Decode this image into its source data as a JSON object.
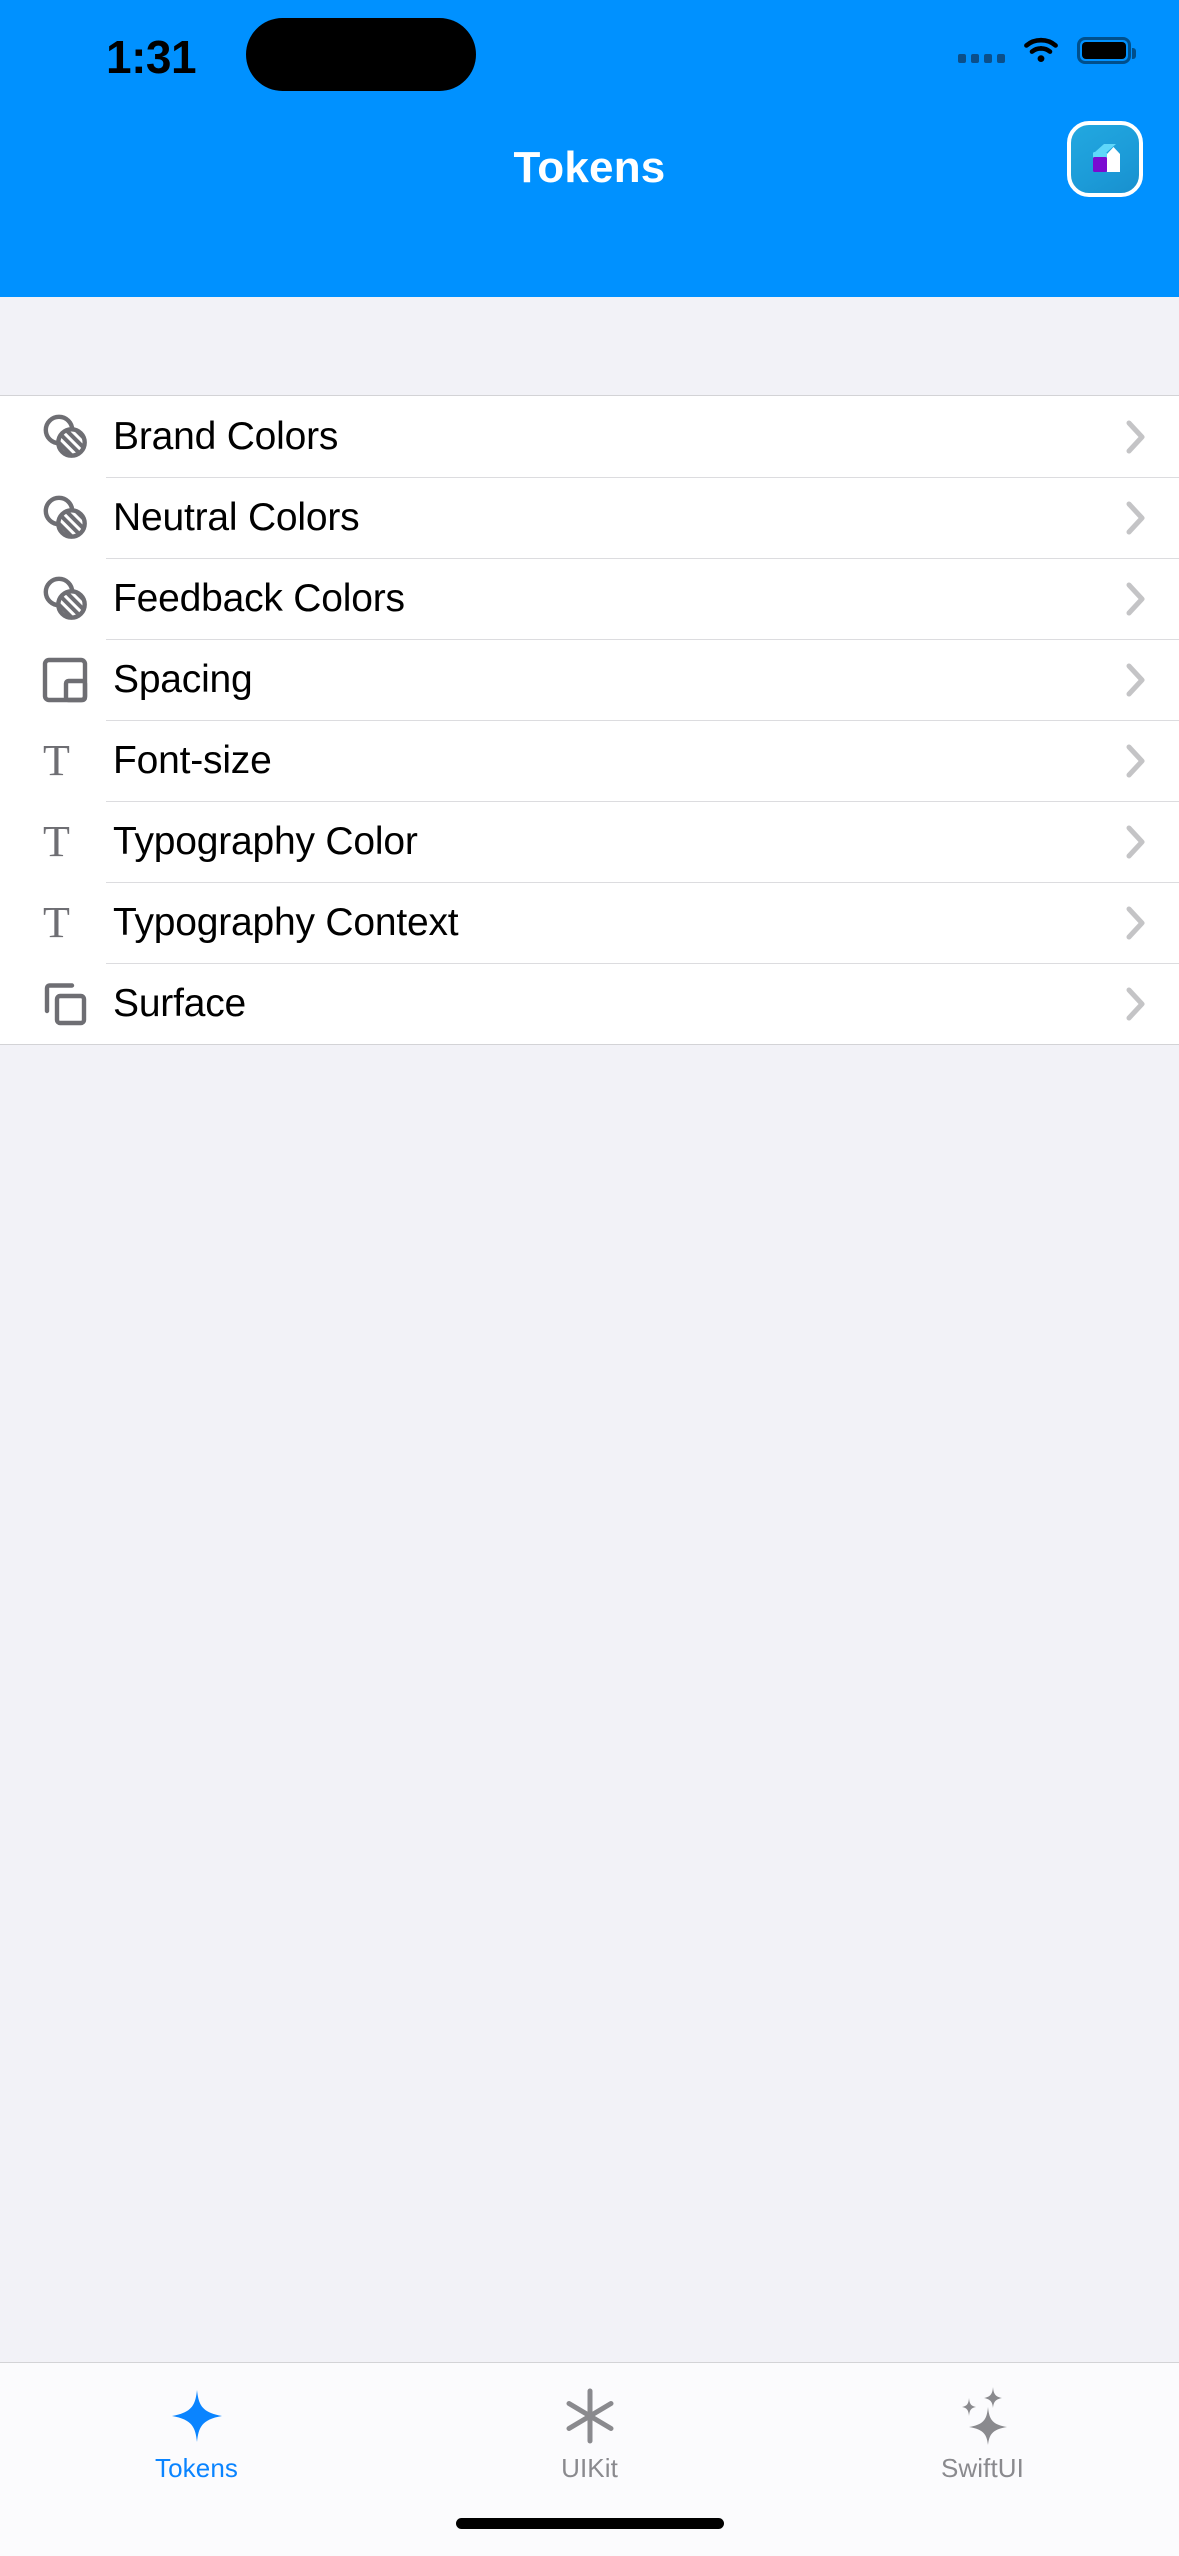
{
  "status_bar": {
    "time": "1:31",
    "cellular_icon": "cellular-bars-icon",
    "wifi_icon": "wifi-icon",
    "battery_icon": "battery-full-icon"
  },
  "nav": {
    "title": "Tokens",
    "right_button_icon": "app-logo-icon",
    "background_color": "#0091FF",
    "title_color": "#FFFFFF"
  },
  "list": {
    "rows": [
      {
        "label": "Brand Colors",
        "icon": "overlapping-circles-icon",
        "accessory": "chevron-right-icon"
      },
      {
        "label": "Neutral Colors",
        "icon": "overlapping-circles-icon",
        "accessory": "chevron-right-icon"
      },
      {
        "label": "Feedback Colors",
        "icon": "overlapping-circles-icon",
        "accessory": "chevron-right-icon"
      },
      {
        "label": "Spacing",
        "icon": "square-inset-icon",
        "accessory": "chevron-right-icon"
      },
      {
        "label": "Font-size",
        "icon": "textformat-t-icon",
        "accessory": "chevron-right-icon"
      },
      {
        "label": "Typography Color",
        "icon": "textformat-t-icon",
        "accessory": "chevron-right-icon"
      },
      {
        "label": "Typography Context",
        "icon": "textformat-t-icon",
        "accessory": "chevron-right-icon"
      },
      {
        "label": "Surface",
        "icon": "square-on-square-icon",
        "accessory": "chevron-right-icon"
      }
    ],
    "row_text_color": "#000000",
    "icon_color": "#6E6E73",
    "chevron_color": "#C4C4C6",
    "background_color": "#FFFFFF"
  },
  "tab_bar": {
    "tabs": [
      {
        "label": "Tokens",
        "icon": "sparkle-icon",
        "selected": true
      },
      {
        "label": "UIKit",
        "icon": "asterisk-icon",
        "selected": false
      },
      {
        "label": "SwiftUI",
        "icon": "sparkles-icon",
        "selected": false
      }
    ],
    "selected_color": "#0A84FF",
    "unselected_color": "#8A8A8E"
  },
  "home_indicator": "home-indicator"
}
